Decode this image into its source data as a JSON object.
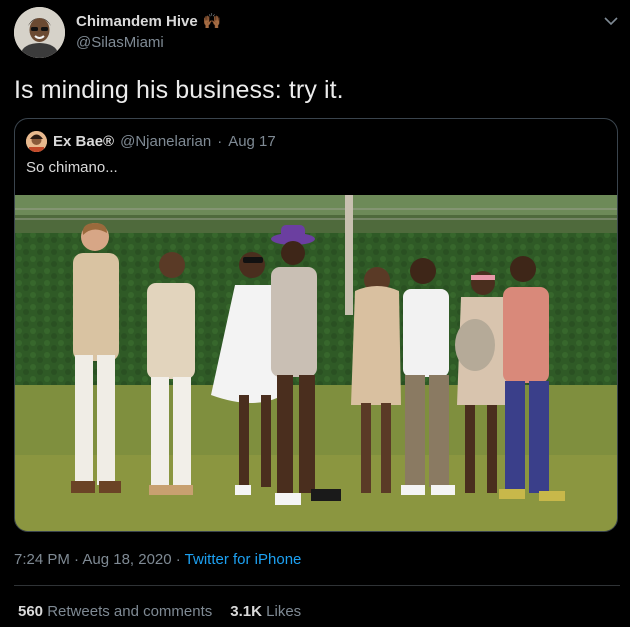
{
  "tweet": {
    "author_name": "Chimandem Hive",
    "author_emoji": "🙌🏾",
    "handle": "@SilasMiami",
    "text": "Is minding his business: try it.",
    "timestamp": "7:24 PM · Aug 18, 2020 · ",
    "source": "Twitter for iPhone"
  },
  "quoted": {
    "name": "Ex Bae®",
    "handle": "@Njanelarian",
    "date": "Aug 17",
    "text": "So chimano..."
  },
  "stats": {
    "retweets_count": "560",
    "retweets_label": "Retweets and comments",
    "likes_count": "3.1K",
    "likes_label": "Likes"
  },
  "icons": {
    "more": "chevron-down-icon"
  },
  "colors": {
    "background": "#000000",
    "link": "#1da1f2",
    "muted": "#7f8a94",
    "border": "#3a444d"
  }
}
